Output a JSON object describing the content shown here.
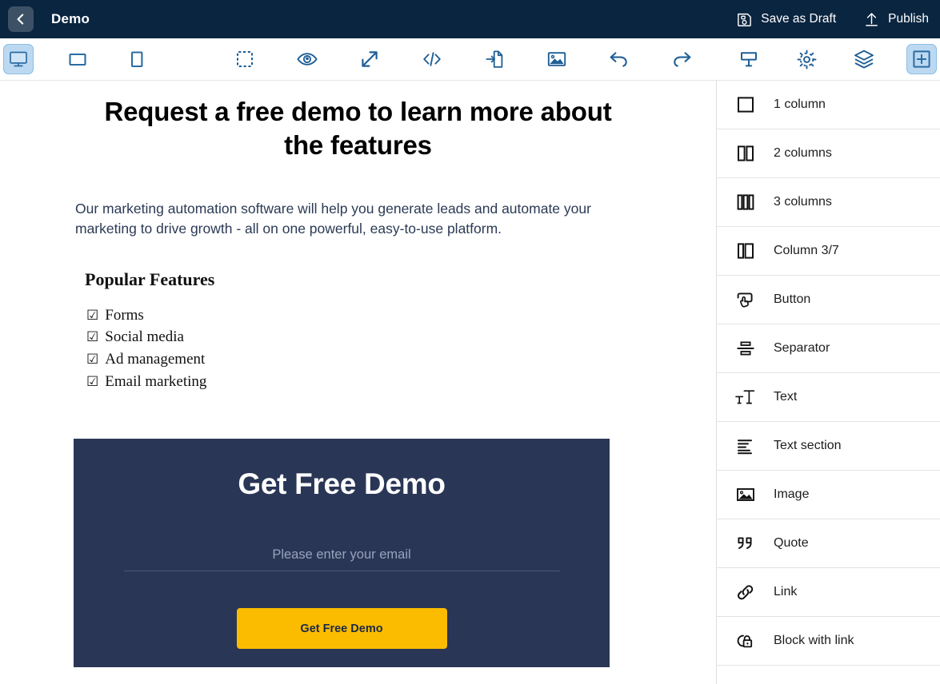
{
  "header": {
    "back_icon": "chevron-left-icon",
    "title": "Demo",
    "actions": [
      {
        "id": "save-as-draft",
        "label": "Save as Draft",
        "icon": "floppy-disk-icon"
      },
      {
        "id": "publish",
        "label": "Publish",
        "icon": "upload-arrow-icon"
      }
    ]
  },
  "toolbar": {
    "devices": [
      {
        "id": "desktop",
        "icon": "desktop-monitor-icon",
        "active": true
      },
      {
        "id": "tablet",
        "icon": "tablet-landscape-icon",
        "active": false
      },
      {
        "id": "mobile",
        "icon": "mobile-portrait-icon",
        "active": false
      }
    ],
    "tools": [
      {
        "id": "select-area",
        "icon": "dashed-selection-icon",
        "active": false
      },
      {
        "id": "preview",
        "icon": "eye-icon",
        "active": false
      },
      {
        "id": "expand",
        "icon": "expand-arrows-icon",
        "active": false
      },
      {
        "id": "code",
        "icon": "code-brackets-icon",
        "active": false
      },
      {
        "id": "import",
        "icon": "import-file-icon",
        "active": false
      },
      {
        "id": "media",
        "icon": "image-icon",
        "active": false
      },
      {
        "id": "undo",
        "icon": "undo-arrow-icon",
        "active": false
      },
      {
        "id": "redo",
        "icon": "redo-arrow-icon",
        "active": false
      }
    ],
    "panels": [
      {
        "id": "popup",
        "icon": "popup-window-icon",
        "active": false
      },
      {
        "id": "settings",
        "icon": "gear-icon",
        "active": false
      },
      {
        "id": "layers",
        "icon": "layers-stack-icon",
        "active": false
      },
      {
        "id": "add-block",
        "icon": "plus-square-icon",
        "active": true
      }
    ]
  },
  "canvas": {
    "hero_title": "Request a free demo to learn more about the features",
    "hero_body": "Our marketing automation software will help you generate leads and automate your marketing to drive growth - all on one powerful, easy-to-use platform.",
    "features_heading": "Popular Features",
    "checkbox_glyph": "☑",
    "features": [
      "Forms",
      "Social media",
      "Ad management",
      "Email marketing"
    ],
    "cta": {
      "title": "Get Free Demo",
      "email_placeholder": "Please enter your email",
      "email_value": "",
      "button_label": "Get Free Demo",
      "background_color": "#2A3656",
      "button_color": "#FBBC00"
    }
  },
  "blocks_panel": {
    "items": [
      {
        "label": "1 column",
        "icon": "one-column-icon"
      },
      {
        "label": "2 columns",
        "icon": "two-columns-icon"
      },
      {
        "label": "3 columns",
        "icon": "three-columns-icon"
      },
      {
        "label": "Column 3/7",
        "icon": "column-three-seven-icon"
      },
      {
        "label": "Button",
        "icon": "button-cursor-icon"
      },
      {
        "label": "Separator",
        "icon": "separator-icon"
      },
      {
        "label": "Text",
        "icon": "text-size-icon"
      },
      {
        "label": "Text section",
        "icon": "text-lines-icon"
      },
      {
        "label": "Image",
        "icon": "image-frame-icon"
      },
      {
        "label": "Quote",
        "icon": "quote-marks-icon"
      },
      {
        "label": "Link",
        "icon": "chain-link-icon"
      },
      {
        "label": "Block with link",
        "icon": "block-with-link-icon"
      }
    ]
  },
  "colors": {
    "header_bg": "#0A2540",
    "accent_blue": "#1F6FB2",
    "cta_navy": "#2A3656",
    "cta_yellow": "#FBBC00"
  }
}
